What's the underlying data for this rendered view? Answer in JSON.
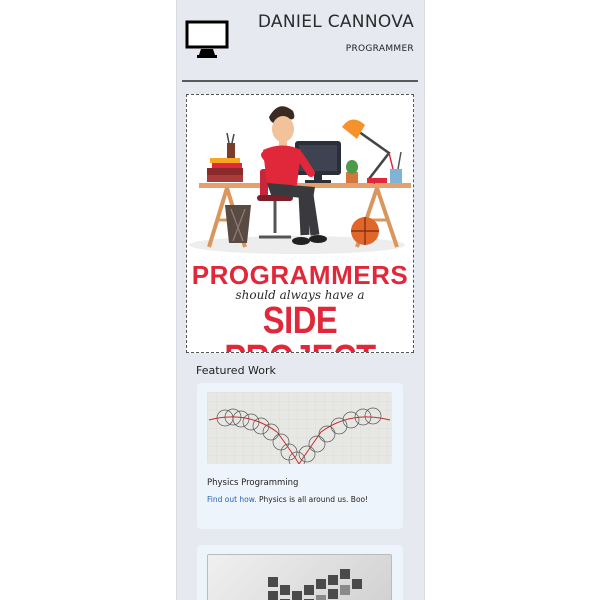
{
  "header": {
    "name": "DANIEL CANNOVA",
    "role": "PROGRAMMER",
    "icon": "monitor-icon"
  },
  "poster": {
    "line1": "PROGRAMMERS",
    "line2": "should always have a",
    "line3": "SIDE PROJECT",
    "accent_color": "#e0283a"
  },
  "featured": {
    "title": "Featured Work",
    "cards": [
      {
        "title": "Physics Programming",
        "link_text": "Find out how.",
        "description": " Physics is all around us. Boo!"
      },
      {}
    ]
  },
  "colors": {
    "page_background": "#e7e9f1",
    "card_background": "#eef4fb",
    "link": "#2762b3"
  }
}
